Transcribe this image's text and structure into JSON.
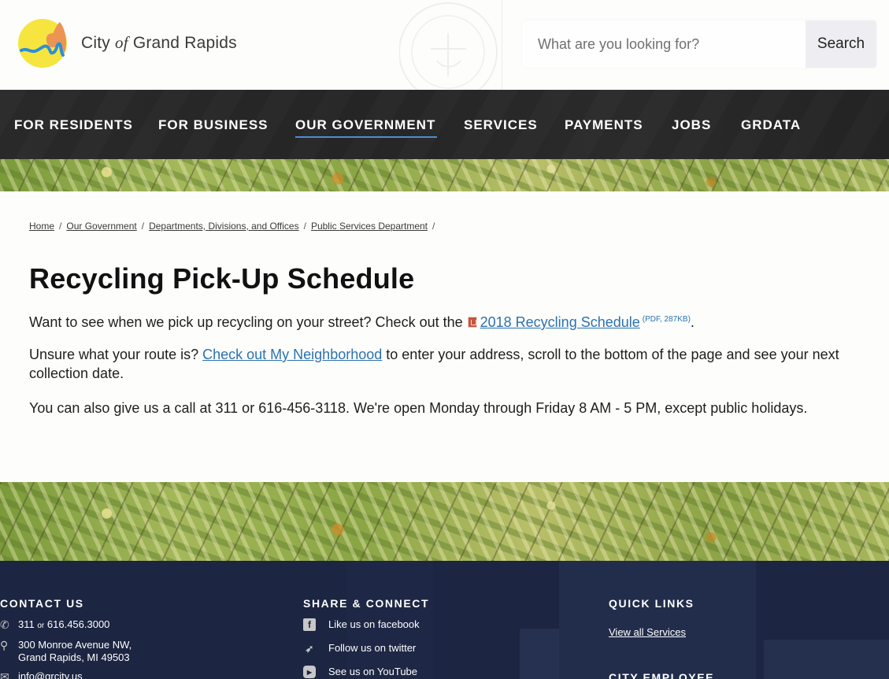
{
  "header": {
    "brand_prefix": "City",
    "brand_of": "of",
    "brand_suffix": "Grand Rapids",
    "search": {
      "placeholder": "What are you looking for?",
      "value": "",
      "button_label": "Search"
    }
  },
  "nav": {
    "items": [
      {
        "label": "FOR RESIDENTS",
        "active": false
      },
      {
        "label": "FOR BUSINESS",
        "active": false
      },
      {
        "label": "OUR GOVERNMENT",
        "active": true
      },
      {
        "label": "SERVICES",
        "active": false
      },
      {
        "label": "PAYMENTS",
        "active": false
      },
      {
        "label": "JOBS",
        "active": false
      },
      {
        "label": "GRDATA",
        "active": false
      }
    ],
    "active_underline_color": "#4a8fd1"
  },
  "breadcrumb": {
    "items": [
      "Home",
      "Our Government",
      "Departments, Divisions, and Offices",
      "Public Services Department"
    ],
    "separator": "/"
  },
  "content": {
    "title": "Recycling Pick-Up Schedule",
    "p1_before": "Want to see when we pick up recycling on your street? Check out the",
    "p1_link": "2018 Recycling Schedule",
    "p1_meta": "(PDF, 287KB)",
    "p1_after": ".",
    "p2_before": "Unsure what your route is?",
    "p2_link": "Check out My Neighborhood",
    "p2_after": "to enter your address, scroll to the bottom of the page and see your next collection date.",
    "p3": "You can also give us a call at 311 or 616-456-3118. We're open Monday through Friday 8 AM - 5 PM, except public holidays.",
    "link_color": "#2a72b0"
  },
  "footer": {
    "contact": {
      "heading": "CONTACT US",
      "phone_main": "311",
      "phone_or": "or",
      "phone_alt": "616.456.3000",
      "address_line1": "300 Monroe Avenue NW,",
      "address_line2": "Grand Rapids, MI 49503",
      "email": "info@grcity.us"
    },
    "share": {
      "heading": "SHARE & CONNECT",
      "items": [
        {
          "icon": "facebook-icon",
          "glyph": "f",
          "label": "Like us on facebook"
        },
        {
          "icon": "twitter-icon",
          "glyph": "🐦",
          "label": "Follow us on twitter"
        },
        {
          "icon": "youtube-icon",
          "glyph": "▶",
          "label": "See us on YouTube"
        }
      ]
    },
    "quick_links": {
      "heading": "QUICK LINKS",
      "items": [
        "View all Services"
      ]
    },
    "city_employee": {
      "heading": "CITY EMPLOYEE"
    },
    "background_color": "#1c2541"
  }
}
